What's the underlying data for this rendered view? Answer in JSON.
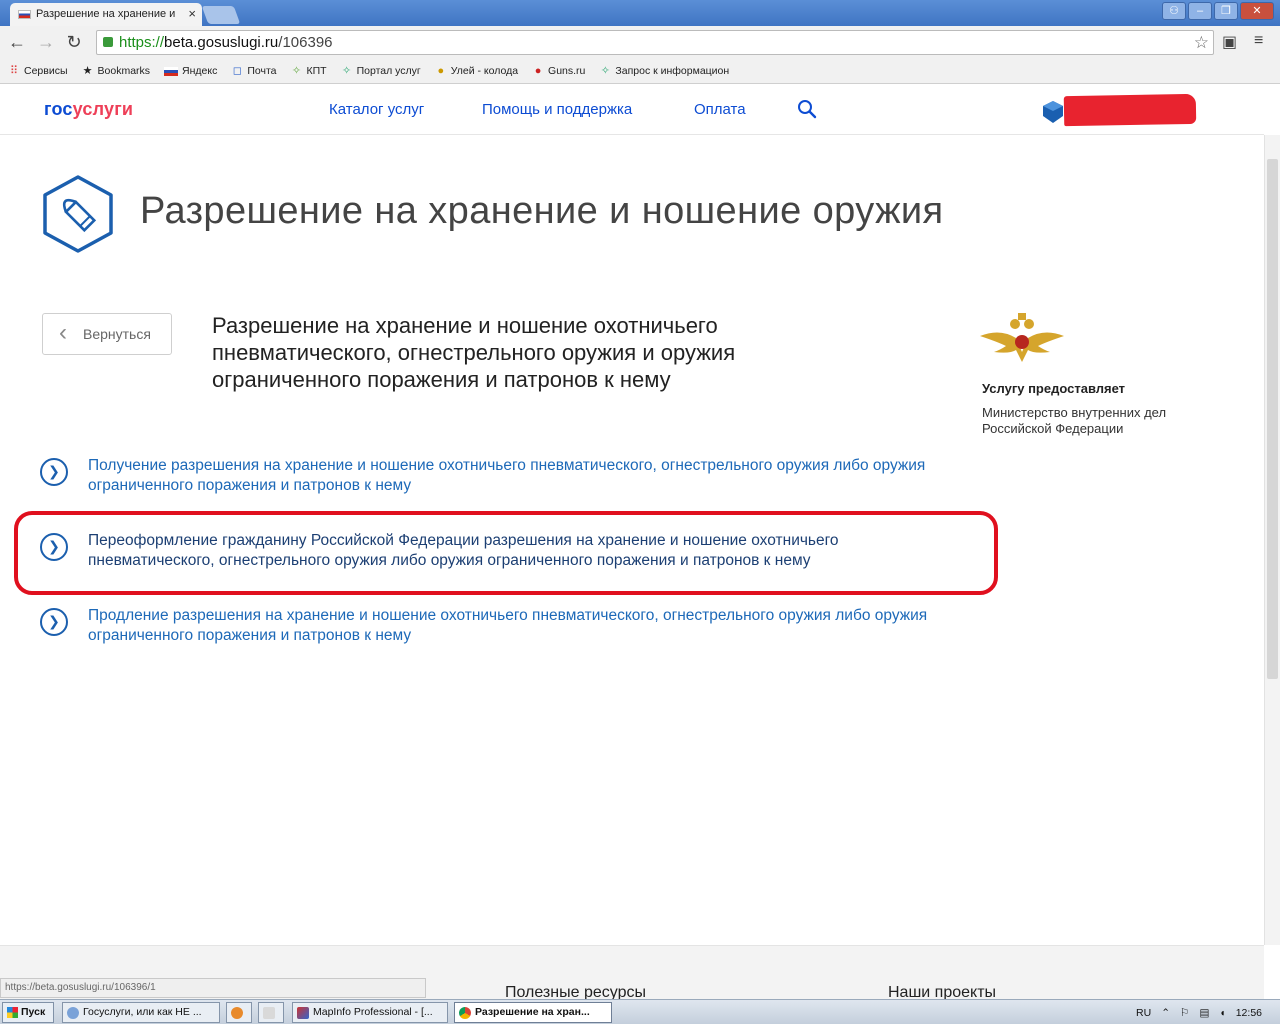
{
  "browser": {
    "tab_title": "Разрешение на хранение и",
    "tab_close": "×",
    "url_scheme": "https://",
    "url_host": "beta.gosuslugi.ru",
    "url_path": "/106396",
    "status_url": "https://beta.gosuslugi.ru/106396/1",
    "bookmarks": [
      "Сервисы",
      "Bookmarks",
      "Яндекс",
      "Почта",
      "КПТ",
      "Портал услуг",
      "Улей - колода",
      "Guns.ru",
      "Запрос к информацион"
    ]
  },
  "site": {
    "logo_primary": "гос",
    "logo_accent": "услуги",
    "nav": {
      "catalog": "Каталог услуг",
      "help": "Помощь и поддержка",
      "payment": "Оплата"
    },
    "user_name": "████████"
  },
  "page": {
    "title": "Разрешение на хранение и ношение оружия",
    "back_label": "Вернуться",
    "service_heading": "Разрешение на хранение и ношение охотничьего пневматического, огнестрельного оружия и оружия ограниченного поражения и патронов к нему",
    "provider_label": "Услугу предоставляет",
    "provider_name": "Министерство внутренних дел Российской Федерации",
    "options": [
      "Получение разрешения на хранение и ношение охотничьего пневматического, огнестрельного оружия либо оружия ограниченного поражения и патронов к нему",
      "Переоформление гражданину Российской Федерации разрешения на хранение и ношение охотничьего пневматического, огнестрельного оружия либо оружия ограниченного поражения и патронов к нему",
      "Продление разрешения на хранение и ношение охотничьего пневматического, огнестрельного оружия либо оружия ограниченного поражения и патронов к нему"
    ]
  },
  "footer": {
    "useful": "Полезные ресурсы",
    "projects": "Наши проекты"
  },
  "taskbar": {
    "start": "Пуск",
    "tasks": [
      "Госуслуги, или как НЕ ...",
      "MapInfo Professional - [...",
      "Разрешение на хран..."
    ],
    "lang": "RU",
    "time": "12:56"
  }
}
